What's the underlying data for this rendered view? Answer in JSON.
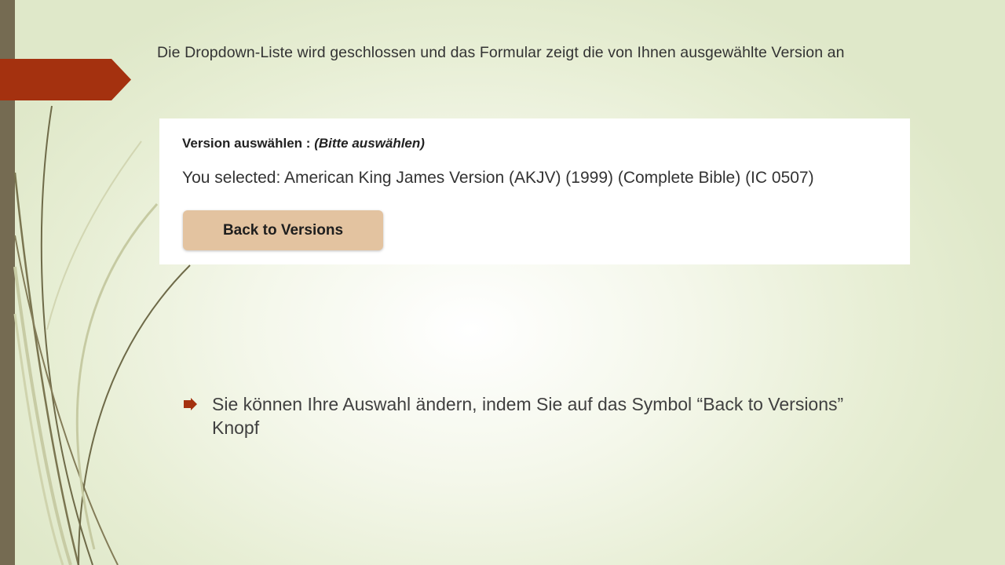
{
  "slide": {
    "heading": "Die Dropdown-Liste wird geschlossen und das Formular zeigt die von Ihnen ausgewählte Version an",
    "accent_colors": {
      "left_bar": "#756b52",
      "arrow": "#a4310f",
      "button": "#e3c3a0"
    }
  },
  "panel": {
    "label": "Version auswählen :",
    "label_hint": "(Bitte auswählen)",
    "selected_text": "You selected: American King James Version (AKJV) (1999) (Complete Bible) (IC 0507)",
    "back_button_label": "Back to Versions"
  },
  "bullets": [
    {
      "icon": "arrow-bullet-icon",
      "text": "Sie können Ihre Auswahl ändern, indem Sie auf das Symbol “Back to Versions” Knopf"
    }
  ]
}
